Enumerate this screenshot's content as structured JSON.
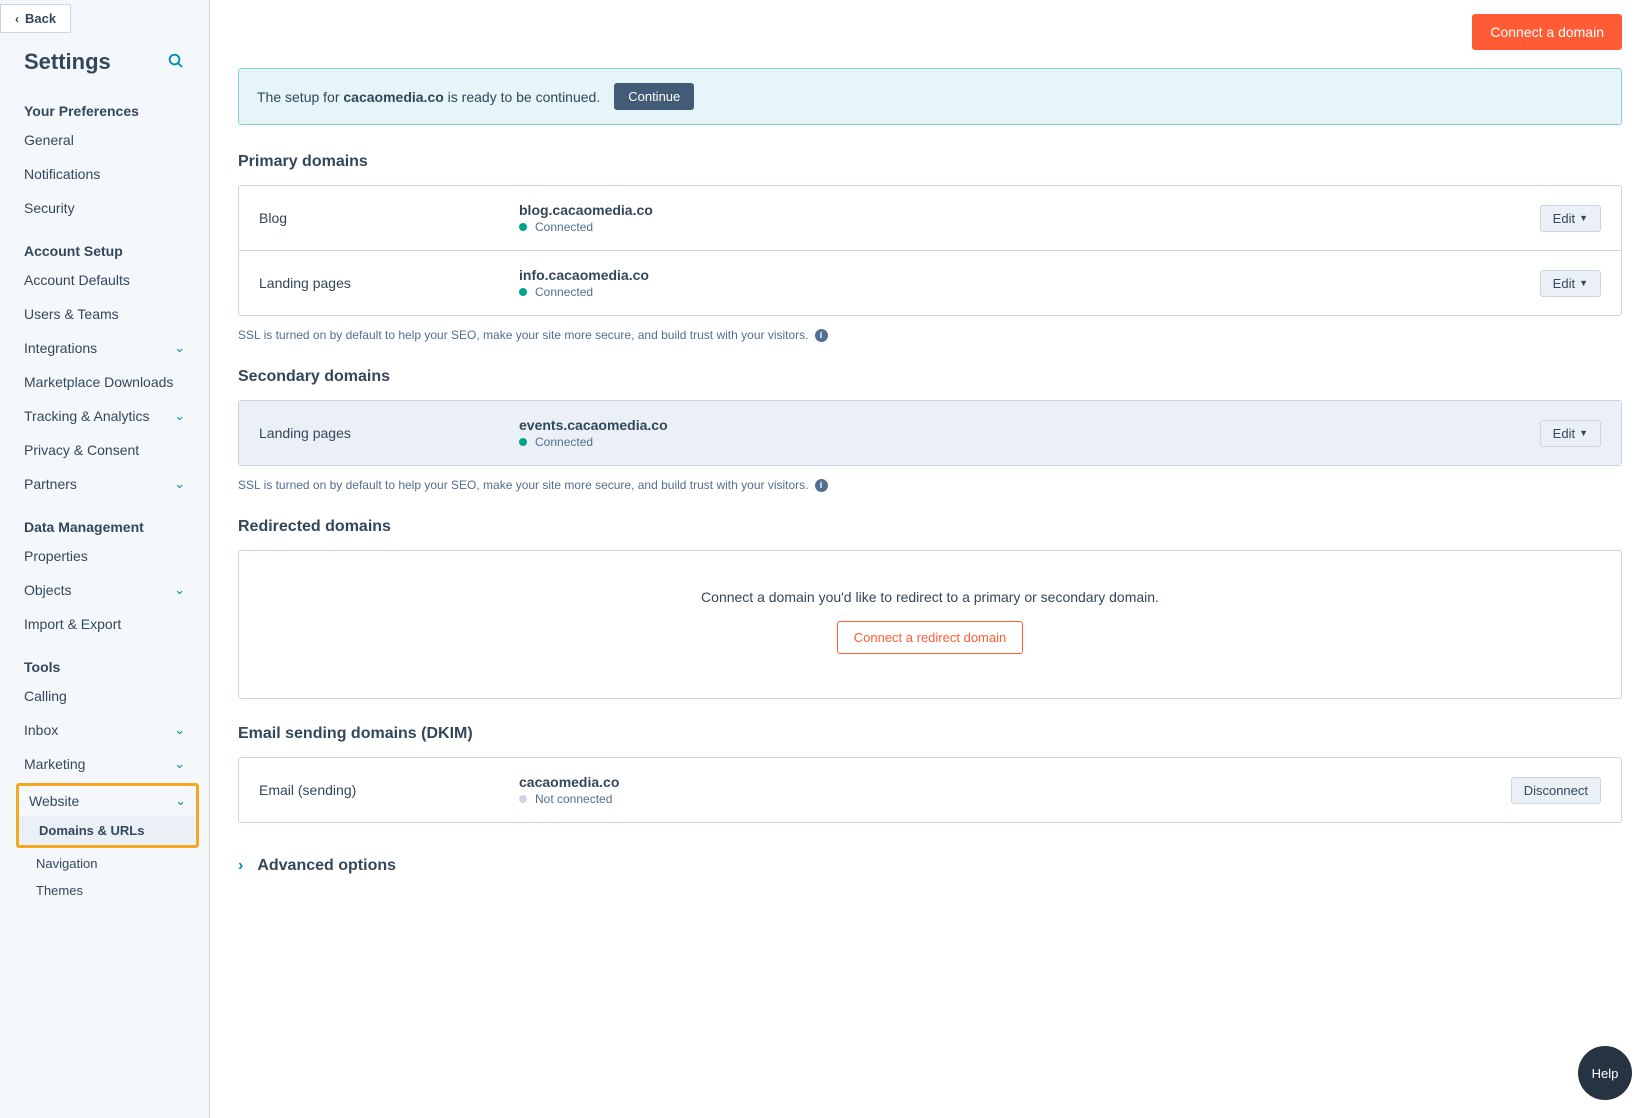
{
  "back": "Back",
  "page_title": "Settings",
  "nav": {
    "preferences": {
      "title": "Your Preferences",
      "general": "General",
      "notifications": "Notifications",
      "security": "Security"
    },
    "account_setup": {
      "title": "Account Setup",
      "defaults": "Account Defaults",
      "users": "Users & Teams",
      "integrations": "Integrations",
      "marketplace": "Marketplace Downloads",
      "tracking": "Tracking & Analytics",
      "privacy": "Privacy & Consent",
      "partners": "Partners"
    },
    "data_mgmt": {
      "title": "Data Management",
      "properties": "Properties",
      "objects": "Objects",
      "import_export": "Import & Export"
    },
    "tools": {
      "title": "Tools",
      "calling": "Calling",
      "inbox": "Inbox",
      "marketing": "Marketing",
      "website": "Website",
      "domains": "Domains & URLs",
      "navigation": "Navigation",
      "themes": "Themes"
    }
  },
  "connect_btn": "Connect a domain",
  "banner": {
    "prefix": "The setup for ",
    "domain": "cacaomedia.co",
    "suffix": " is ready to be continued.",
    "continue": "Continue"
  },
  "primary": {
    "heading": "Primary domains",
    "rows": [
      {
        "label": "Blog",
        "domain": "blog.cacaomedia.co",
        "status": "Connected"
      },
      {
        "label": "Landing pages",
        "domain": "info.cacaomedia.co",
        "status": "Connected"
      }
    ],
    "edit": "Edit"
  },
  "ssl_note": "SSL is turned on by default to help your SEO, make your site more secure, and build trust with your visitors.",
  "secondary": {
    "heading": "Secondary domains",
    "rows": [
      {
        "label": "Landing pages",
        "domain": "events.cacaomedia.co",
        "status": "Connected"
      }
    ],
    "edit": "Edit"
  },
  "redirected": {
    "heading": "Redirected domains",
    "empty": "Connect a domain you'd like to redirect to a primary or secondary domain.",
    "cta": "Connect a redirect domain"
  },
  "email": {
    "heading": "Email sending domains (DKIM)",
    "row": {
      "label": "Email (sending)",
      "domain": "cacaomedia.co",
      "status": "Not connected"
    },
    "disconnect": "Disconnect"
  },
  "advanced": "Advanced options",
  "help": "Help"
}
